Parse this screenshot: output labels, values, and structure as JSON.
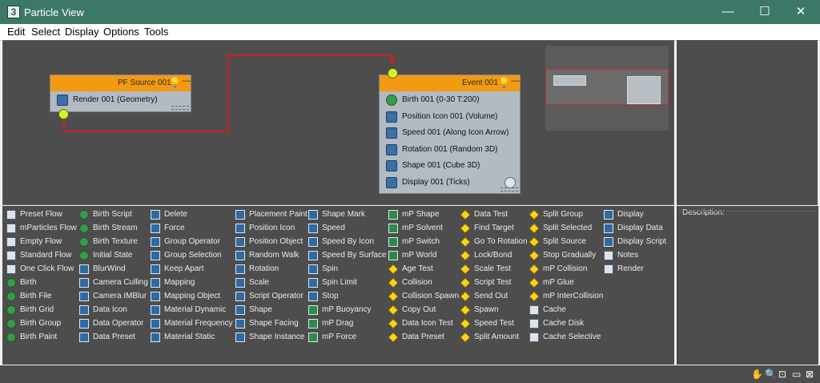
{
  "window": {
    "title": "Particle View",
    "app_icon": "3"
  },
  "window_controls": {
    "minimize": "—",
    "maximize": "☐",
    "close": "✕"
  },
  "menu": [
    "Edit",
    "Select",
    "Display",
    "Options",
    "Tools"
  ],
  "colors": {
    "accent_header": "#f29a12",
    "wire": "#cc2020",
    "port": "#d6f02a",
    "canvas": "#4d4d4d"
  },
  "nodes": {
    "source": {
      "title": "PF Source 001",
      "operators": [
        "Render 001 (Geometry)"
      ]
    },
    "event": {
      "title": "Event 001",
      "operators": [
        "Birth 001 (0-30 T:200)",
        "Position Icon 001 (Volume)",
        "Speed 001 (Along Icon Arrow)",
        "Rotation 001 (Random 3D)",
        "Shape 001 (Cube 3D)",
        "Display 001 (Ticks)"
      ]
    }
  },
  "depot": {
    "columns": [
      [
        {
          "label": "Preset Flow",
          "icon": "flow"
        },
        {
          "label": "mParticles Flow",
          "icon": "flow"
        },
        {
          "label": "Empty Flow",
          "icon": "flow"
        },
        {
          "label": "Standard Flow",
          "icon": "flow"
        },
        {
          "label": "One Click Flow",
          "icon": "flow"
        },
        {
          "label": "Birth",
          "icon": "birth"
        },
        {
          "label": "Birth File",
          "icon": "birth"
        },
        {
          "label": "Birth Grid",
          "icon": "birth"
        },
        {
          "label": "Birth Group",
          "icon": "birth"
        },
        {
          "label": "Birth Paint",
          "icon": "birth"
        }
      ],
      [
        {
          "label": "Birth Script",
          "icon": "birth"
        },
        {
          "label": "Birth Stream",
          "icon": "birth"
        },
        {
          "label": "Birth Texture",
          "icon": "birth"
        },
        {
          "label": "Initial State",
          "icon": "birth"
        },
        {
          "label": "BlurWind",
          "icon": "op"
        },
        {
          "label": "Camera Culling",
          "icon": "op"
        },
        {
          "label": "Camera IMBlur",
          "icon": "op"
        },
        {
          "label": "Data Icon",
          "icon": "op"
        },
        {
          "label": "Data Operator",
          "icon": "op"
        },
        {
          "label": "Data Preset",
          "icon": "op"
        }
      ],
      [
        {
          "label": "Delete",
          "icon": "op"
        },
        {
          "label": "Force",
          "icon": "op"
        },
        {
          "label": "Group Operator",
          "icon": "op"
        },
        {
          "label": "Group Selection",
          "icon": "op"
        },
        {
          "label": "Keep Apart",
          "icon": "op"
        },
        {
          "label": "Mapping",
          "icon": "op"
        },
        {
          "label": "Mapping Object",
          "icon": "op"
        },
        {
          "label": "Material Dynamic",
          "icon": "op"
        },
        {
          "label": "Material Frequency",
          "icon": "op"
        },
        {
          "label": "Material Static",
          "icon": "op"
        }
      ],
      [
        {
          "label": "Placement Paint",
          "icon": "op"
        },
        {
          "label": "Position Icon",
          "icon": "op"
        },
        {
          "label": "Position Object",
          "icon": "op"
        },
        {
          "label": "Random Walk",
          "icon": "op"
        },
        {
          "label": "Rotation",
          "icon": "op"
        },
        {
          "label": "Scale",
          "icon": "op"
        },
        {
          "label": "Script Operator",
          "icon": "op"
        },
        {
          "label": "Shape",
          "icon": "op"
        },
        {
          "label": "Shape Facing",
          "icon": "op"
        },
        {
          "label": "Shape Instance",
          "icon": "op"
        }
      ],
      [
        {
          "label": "Shape Mark",
          "icon": "op"
        },
        {
          "label": "Speed",
          "icon": "op"
        },
        {
          "label": "Speed By Icon",
          "icon": "op"
        },
        {
          "label": "Speed By Surface",
          "icon": "op"
        },
        {
          "label": "Spin",
          "icon": "op"
        },
        {
          "label": "Spin Limit",
          "icon": "op"
        },
        {
          "label": "Stop",
          "icon": "op"
        },
        {
          "label": "mP Buoyancy",
          "icon": "mp"
        },
        {
          "label": "mP Drag",
          "icon": "mp"
        },
        {
          "label": "mP Force",
          "icon": "mp"
        }
      ],
      [
        {
          "label": "mP Shape",
          "icon": "mp"
        },
        {
          "label": "mP Solvent",
          "icon": "mp"
        },
        {
          "label": "mP Switch",
          "icon": "mp"
        },
        {
          "label": "mP World",
          "icon": "mp"
        },
        {
          "label": "Age Test",
          "icon": "test"
        },
        {
          "label": "Collision",
          "icon": "test"
        },
        {
          "label": "Collision Spawn",
          "icon": "test"
        },
        {
          "label": "Copy Out",
          "icon": "test"
        },
        {
          "label": "Data Icon Test",
          "icon": "test"
        },
        {
          "label": "Data Preset",
          "icon": "test"
        }
      ],
      [
        {
          "label": "Data Test",
          "icon": "test"
        },
        {
          "label": "Find Target",
          "icon": "test"
        },
        {
          "label": "Go To Rotation",
          "icon": "test"
        },
        {
          "label": "Lock/Bond",
          "icon": "test"
        },
        {
          "label": "Scale Test",
          "icon": "test"
        },
        {
          "label": "Script Test",
          "icon": "test"
        },
        {
          "label": "Send Out",
          "icon": "test"
        },
        {
          "label": "Spawn",
          "icon": "test"
        },
        {
          "label": "Speed Test",
          "icon": "test"
        },
        {
          "label": "Split Amount",
          "icon": "test"
        }
      ],
      [
        {
          "label": "Split Group",
          "icon": "test"
        },
        {
          "label": "Split Selected",
          "icon": "test"
        },
        {
          "label": "Split Source",
          "icon": "test"
        },
        {
          "label": "Stop Gradually",
          "icon": "test"
        },
        {
          "label": "mP Collision",
          "icon": "test"
        },
        {
          "label": "mP Glue",
          "icon": "test"
        },
        {
          "label": "mP InterCollision",
          "icon": "test"
        },
        {
          "label": "Cache",
          "icon": "util"
        },
        {
          "label": "Cache Disk",
          "icon": "util"
        },
        {
          "label": "Cache Selective",
          "icon": "util"
        }
      ],
      [
        {
          "label": "Display",
          "icon": "op"
        },
        {
          "label": "Display Data",
          "icon": "op"
        },
        {
          "label": "Display Script",
          "icon": "op"
        },
        {
          "label": "Notes",
          "icon": "util"
        },
        {
          "label": "Render",
          "icon": "util"
        }
      ]
    ]
  },
  "description": {
    "label": "Description:"
  },
  "status_icons": [
    "pan-icon",
    "zoom-icon",
    "zoom-region-icon",
    "zoom-extents-icon",
    "no-zoom-icon"
  ],
  "status_glyphs": [
    "✋",
    "🔍",
    "⊡",
    "▭",
    "⊠"
  ]
}
